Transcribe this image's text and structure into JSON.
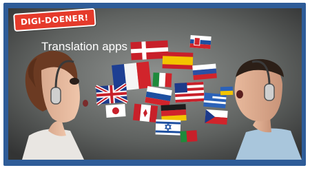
{
  "brand": {
    "badge_text": "DIGI-DOENER!",
    "badge_color": "#e53a2b"
  },
  "hero": {
    "title": "Translation apps"
  },
  "colors": {
    "frame": "#2e5c98",
    "background_dark": "#3a3b3b",
    "background_light": "#8f9290"
  }
}
